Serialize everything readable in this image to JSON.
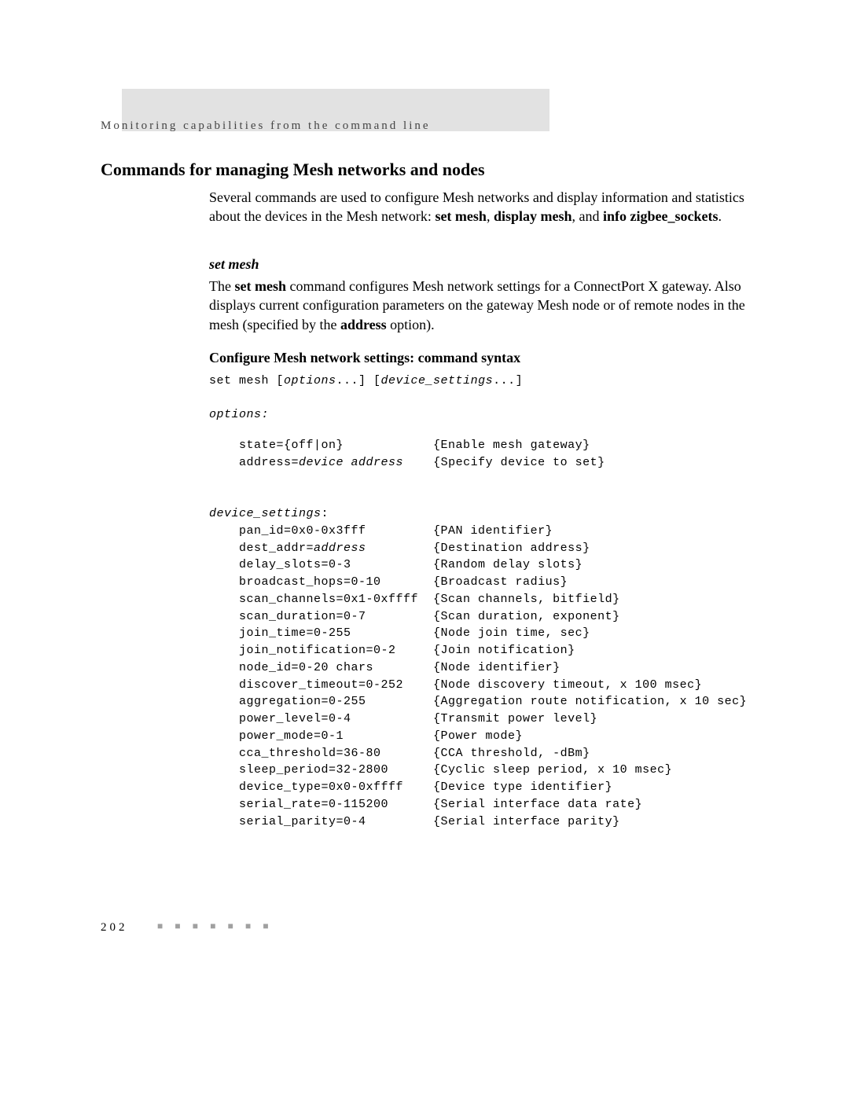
{
  "header": "Monitoring capabilities from the command line",
  "section_title": "Commands for managing Mesh networks and nodes",
  "intro": {
    "pre": "Several commands are used to configure Mesh networks and display information and statistics about the devices in the Mesh network: ",
    "b1": "set mesh",
    "sep1": ", ",
    "b2": "display mesh",
    "sep2": ", and ",
    "b3": "info zigbee_sockets",
    "tail": "."
  },
  "subheading1": "set mesh",
  "para1": {
    "p1a": "The ",
    "p1b": "set mesh",
    "p1c": " command configures Mesh network settings for a ConnectPort X gateway. Also displays current configuration parameters on the gateway Mesh node or of remote nodes in the mesh (specified by the ",
    "p1d": "address",
    "p1e": " option)."
  },
  "subheading2": "Configure Mesh network settings: command syntax",
  "cmd": {
    "lead": "set mesh [",
    "i1": "options",
    "mid": "...] [",
    "i2": "device_settings",
    "tail": "...]"
  },
  "options_label": "options:",
  "options": {
    "line1_a": "    state={off|on}            {Enable mesh gateway}",
    "line2_a": "    address=",
    "line2_i": "device address",
    "line2_b": "    {Specify device to set}"
  },
  "dev_label": "device_settings",
  "dev_label_tail": ":",
  "dev": {
    "l1": "    pan_id=0x0-0x3fff         {PAN identifier}",
    "l2a": "    dest_addr=",
    "l2i": "address",
    "l2b": "         {Destination address}",
    "l3": "    delay_slots=0-3           {Random delay slots}",
    "l4": "    broadcast_hops=0-10       {Broadcast radius}",
    "l5": "    scan_channels=0x1-0xffff  {Scan channels, bitfield}",
    "l6": "    scan_duration=0-7         {Scan duration, exponent}",
    "l7": "    join_time=0-255           {Node join time, sec}",
    "l8": "    join_notification=0-2     {Join notification}",
    "l9": "    node_id=0-20 chars        {Node identifier}",
    "l10": "    discover_timeout=0-252    {Node discovery timeout, x 100 msec}",
    "l11": "    aggregation=0-255         {Aggregation route notification, x 10 sec}",
    "l12": "    power_level=0-4           {Transmit power level}",
    "l13": "    power_mode=0-1            {Power mode}",
    "l14": "    cca_threshold=36-80       {CCA threshold, -dBm}",
    "l15": "    sleep_period=32-2800      {Cyclic sleep period, x 10 msec}",
    "l16": "    device_type=0x0-0xffff    {Device type identifier}",
    "l17": "    serial_rate=0-115200      {Serial interface data rate}",
    "l18": "    serial_parity=0-4         {Serial interface parity}"
  },
  "page_number": "202",
  "dots": "■ ■ ■ ■ ■ ■ ■"
}
